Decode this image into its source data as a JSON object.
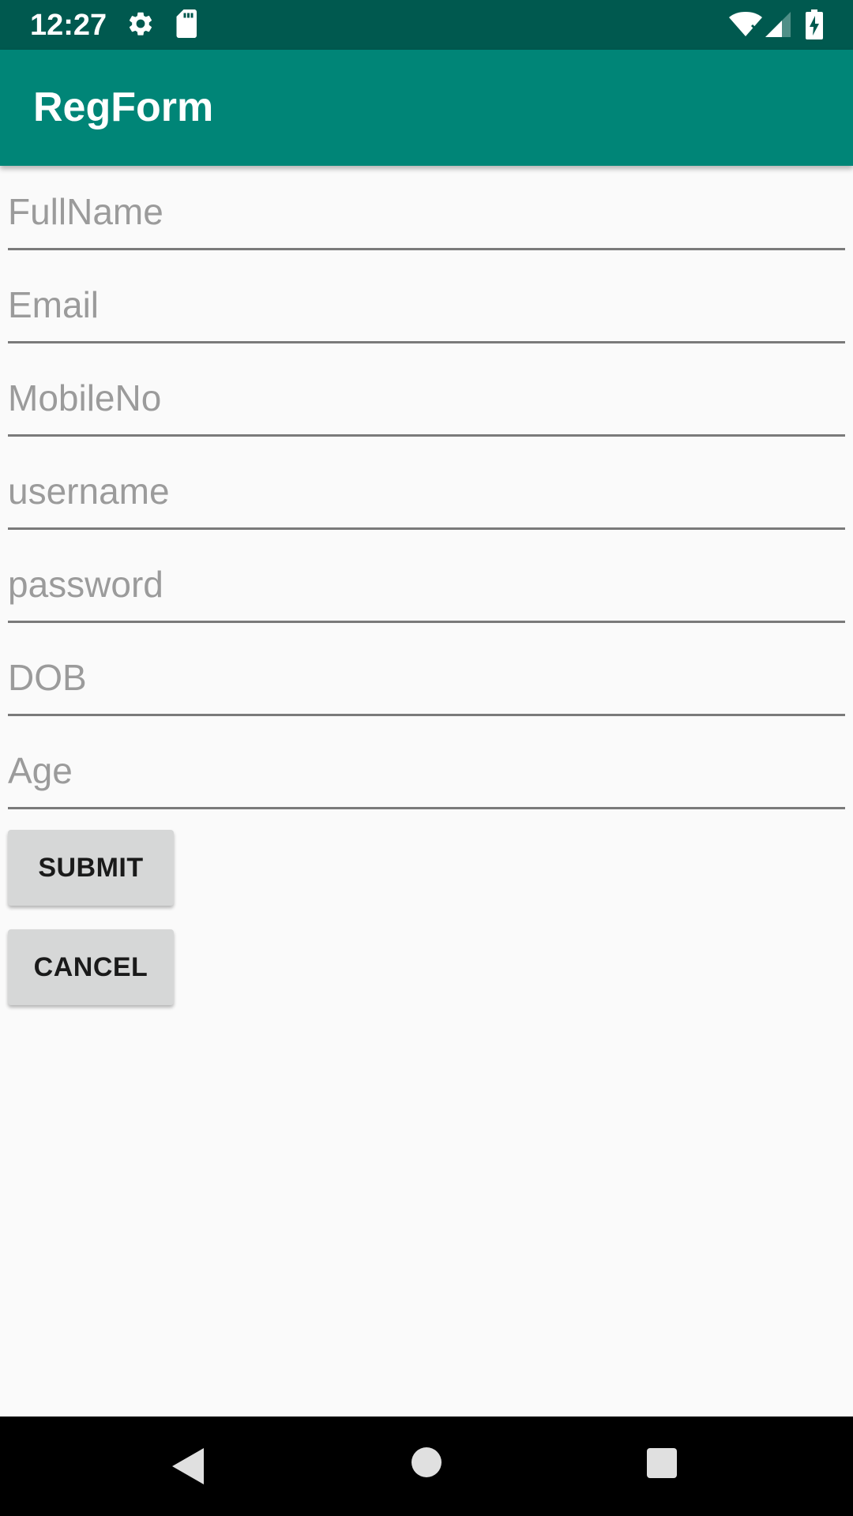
{
  "status_bar": {
    "time": "12:27",
    "icons": [
      "settings-icon",
      "sd-card-icon",
      "wifi-icon",
      "signal-icon",
      "battery-charging-icon"
    ]
  },
  "app_bar": {
    "title": "RegForm",
    "color": "#008577"
  },
  "form": {
    "fields": [
      {
        "name": "fullname",
        "placeholder": "FullName",
        "value": ""
      },
      {
        "name": "email",
        "placeholder": "Email",
        "value": ""
      },
      {
        "name": "mobileno",
        "placeholder": "MobileNo",
        "value": ""
      },
      {
        "name": "username",
        "placeholder": "username",
        "value": ""
      },
      {
        "name": "password",
        "placeholder": "password",
        "value": ""
      },
      {
        "name": "dob",
        "placeholder": "DOB",
        "value": ""
      },
      {
        "name": "age",
        "placeholder": "Age",
        "value": ""
      }
    ],
    "submit_label": "SUBMIT",
    "cancel_label": "CANCEL"
  },
  "nav_bar": {
    "icons": [
      "back-icon",
      "home-icon",
      "recents-icon"
    ]
  },
  "colors": {
    "status_bar": "#00594f",
    "app_bar": "#008577",
    "background": "#fafafa",
    "button": "#d6d7d7"
  }
}
